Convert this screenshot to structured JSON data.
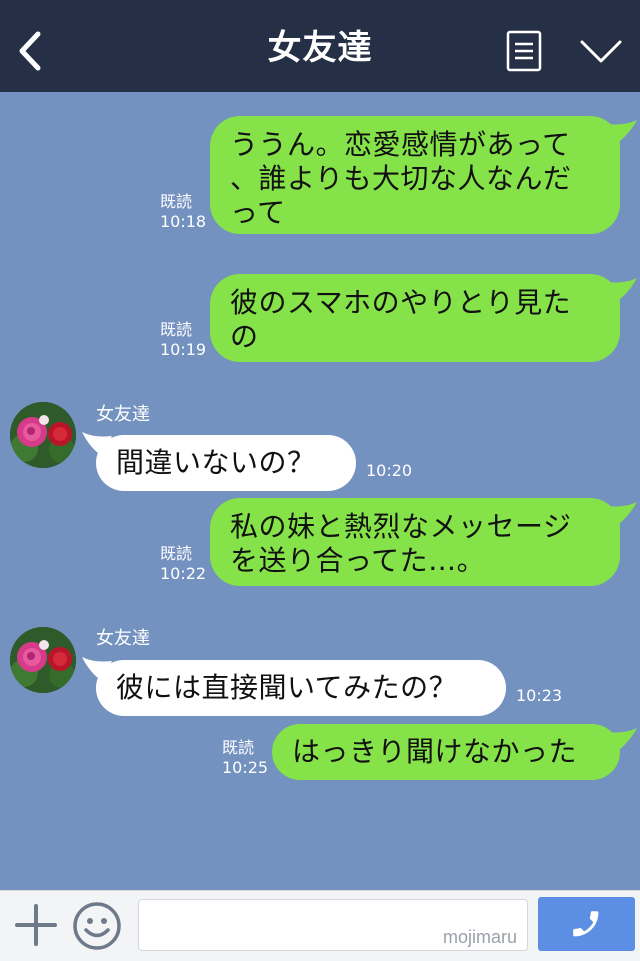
{
  "header": {
    "title": "女友達",
    "back_icon": "chevron-left-icon",
    "menu_icon": "menu-list-icon",
    "collapse_icon": "chevron-down-icon"
  },
  "colors": {
    "header_bg": "#253047",
    "chat_bg": "#7392c0",
    "outgoing_bubble": "#85e249",
    "incoming_bubble": "#ffffff",
    "call_button": "#5c8ee3"
  },
  "messages": [
    {
      "dir": "out",
      "lines": [
        "ううん。恋愛感情があって",
        "、誰よりも大切な人なんだ",
        "って"
      ],
      "read": "既読",
      "time": "10:18"
    },
    {
      "dir": "out",
      "lines": [
        "彼のスマホのやりとり見た",
        "の"
      ],
      "read": "既読",
      "time": "10:19"
    },
    {
      "dir": "in",
      "sender": "女友達",
      "lines": [
        "間違いないの？"
      ],
      "time": "10:20"
    },
    {
      "dir": "out",
      "lines": [
        "私の妹と熱烈なメッセージ",
        "を送り合ってた…。"
      ],
      "read": "既読",
      "time": "10:22"
    },
    {
      "dir": "in",
      "sender": "女友達",
      "lines": [
        "彼には直接聞いてみたの？"
      ],
      "time": "10:23"
    },
    {
      "dir": "out",
      "lines": [
        "はっきり聞けなかった"
      ],
      "read": "既読",
      "time": "10:25"
    }
  ],
  "input": {
    "placeholder": "",
    "watermark": "mojimaru",
    "plus_icon": "plus-icon",
    "emoji_icon": "smiley-icon",
    "call_icon": "phone-icon"
  }
}
